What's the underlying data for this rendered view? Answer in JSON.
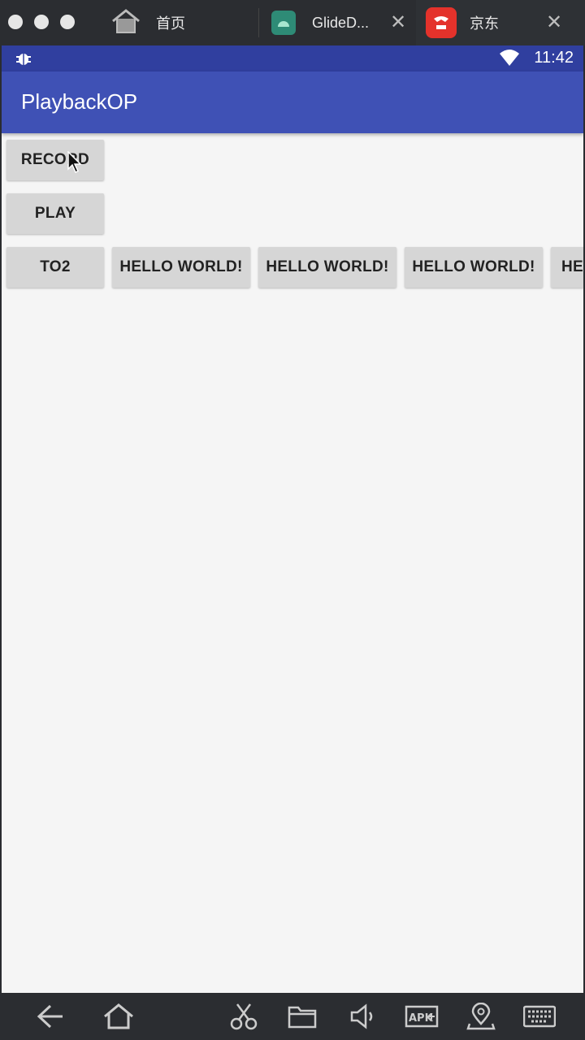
{
  "tabbar": {
    "tabs": [
      {
        "label": "首页",
        "icon": "home-icon"
      },
      {
        "label": "GlideD...",
        "icon": "android-icon"
      },
      {
        "label": "京东",
        "icon": "jd-app-icon"
      }
    ],
    "close_symbol": "✕"
  },
  "statusbar": {
    "time": "11:42"
  },
  "appbar": {
    "title": "PlaybackOP"
  },
  "buttons": {
    "record": "RECORD",
    "play": "PLAY",
    "to2": "TO2",
    "hello1": "HELLO WORLD!",
    "hello2": "HELLO WORLD!",
    "hello3": "HELLO WORLD!",
    "hello4": "HELLO WORLD!"
  },
  "bottombar": {
    "tools": [
      "back-icon",
      "home-icon",
      "scissors-icon",
      "folder-icon",
      "volume-icon",
      "apk-install-icon",
      "location-icon",
      "keyboard-icon"
    ],
    "apk_text": "APK"
  },
  "colors": {
    "statusbar": "#303f9f",
    "appbar": "#3f51b5",
    "background": "#f5f5f5",
    "button": "#d6d6d6"
  }
}
